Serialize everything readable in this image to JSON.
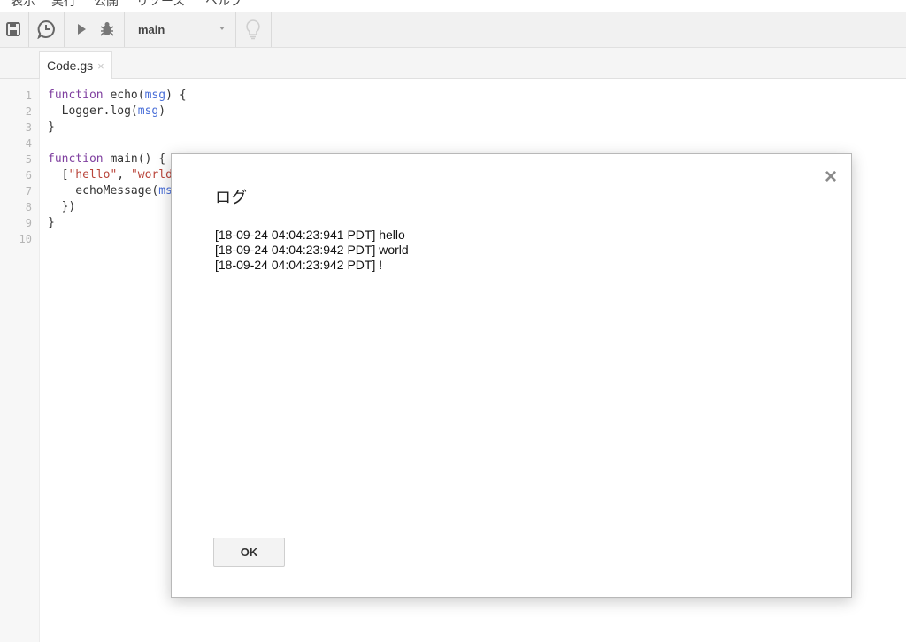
{
  "menubar": {
    "items": [
      "表示",
      "実行",
      "公開",
      "リソース",
      "ヘルプ"
    ]
  },
  "toolbar": {
    "function_select": "main",
    "icons": [
      "save-icon",
      "clock-icon",
      "play-icon",
      "bug-icon",
      "lightbulb-icon"
    ]
  },
  "tabs": [
    {
      "label": "Code.gs",
      "close": "×"
    }
  ],
  "editor": {
    "line_numbers": [
      "1",
      "2",
      "3",
      "4",
      "5",
      "6",
      "7",
      "8",
      "9",
      "10"
    ]
  },
  "dialog": {
    "title": "ログ",
    "close": "×",
    "log_lines": [
      "[18-09-24 04:04:23:941 PDT] hello",
      "[18-09-24 04:04:23:942 PDT] world",
      "[18-09-24 04:04:23:942 PDT] !"
    ],
    "ok_label": "OK"
  },
  "colors": {
    "keyword": "#7f3f9f",
    "variable": "#4a6fd8",
    "string": "#b9453b",
    "toolbar_bg": "#f1f1f1"
  }
}
